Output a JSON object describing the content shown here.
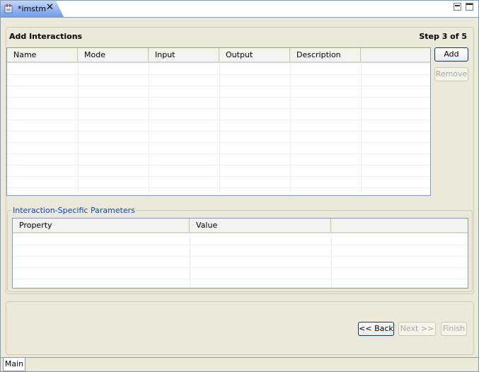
{
  "editor_tab": {
    "title": "*imstm",
    "icon": "plan-file-icon",
    "close_icon": "close-icon"
  },
  "window_controls": [
    "minimize-icon",
    "maximize-icon"
  ],
  "page": {
    "title": "Add Interactions",
    "step": "Step 3 of 5"
  },
  "interactions_table": {
    "columns": [
      "Name",
      "Mode",
      "Input",
      "Output",
      "Description"
    ],
    "rows": []
  },
  "side_buttons": {
    "add": "Add",
    "remove": "Remove"
  },
  "parameters": {
    "legend": "Interaction-Specific Parameters",
    "columns": [
      "Property",
      "Value"
    ],
    "rows": []
  },
  "wizard_buttons": {
    "back": "<< Back",
    "next": "Next >>",
    "finish": "Finish"
  },
  "bottom_tabs": [
    "Main"
  ],
  "colors": {
    "background": "#ece9d8",
    "accent": "#0046d5",
    "border": "#7f9db9"
  }
}
